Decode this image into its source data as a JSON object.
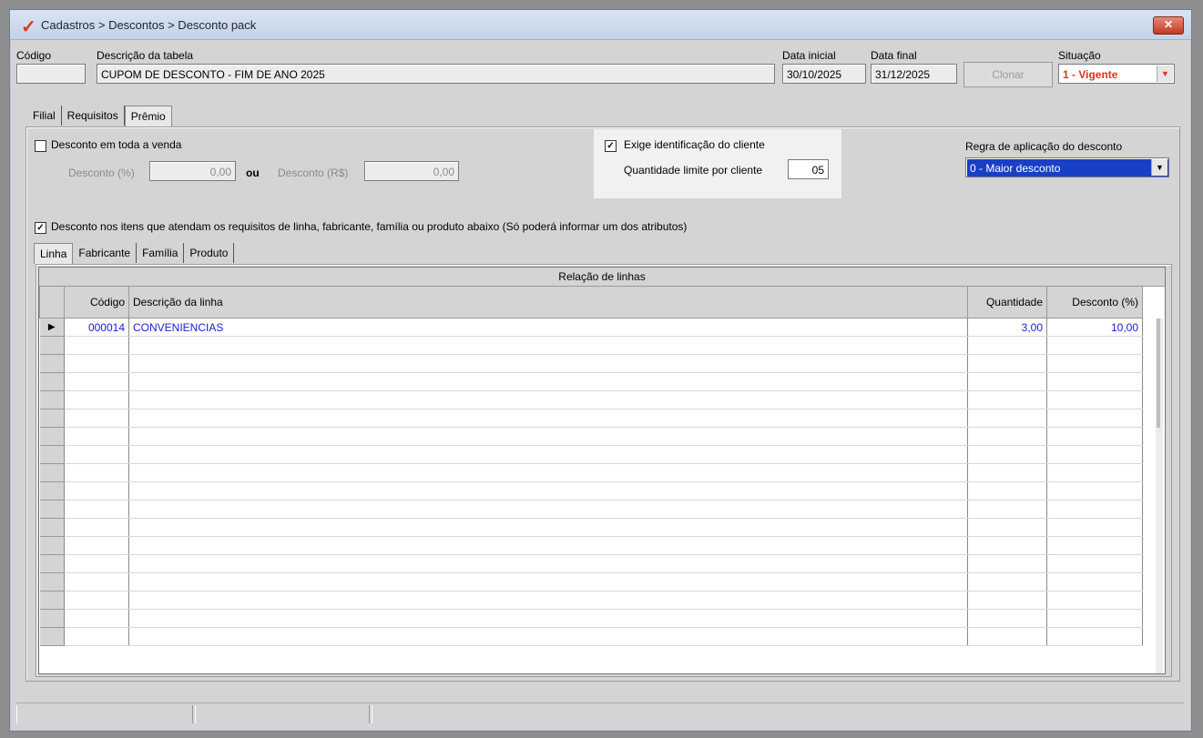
{
  "window": {
    "title": "Cadastros > Descontos > Desconto pack",
    "close_label": "✕"
  },
  "header": {
    "codigo_label": "Código",
    "codigo_value": "",
    "descricao_label": "Descrição da tabela",
    "descricao_value": "CUPOM DE DESCONTO - FIM DE ANO 2025",
    "data_inicial_label": "Data inicial",
    "data_inicial_value": "30/10/2025",
    "data_final_label": "Data final",
    "data_final_value": "31/12/2025",
    "clonar_label": "Clonar",
    "situacao_label": "Situação",
    "situacao_value": "1 - Vigente"
  },
  "tabs": [
    "Filial",
    "Requisitos",
    "Prêmio"
  ],
  "premio": {
    "desconto_toda_venda_label": "Desconto em toda a venda",
    "desconto_pct_label": "Desconto (%)",
    "desconto_pct_value": "0,00",
    "ou_label": "ou",
    "desconto_rs_label": "Desconto (R$)",
    "desconto_rs_value": "0,00",
    "exige_identificacao_label": "Exige identificação do cliente",
    "quantidade_limite_label": "Quantidade limite por cliente",
    "quantidade_limite_value": "05",
    "regra_label": "Regra de aplicação do desconto",
    "regra_value": "0 - Maior desconto",
    "desconto_itens_label": "Desconto nos itens que atendam os requisitos de linha, fabricante, família ou produto abaixo (Só poderá informar um dos atributos)"
  },
  "subtabs": [
    "Linha",
    "Fabricante",
    "Família",
    "Produto"
  ],
  "grid": {
    "caption": "Relação de linhas",
    "headers": [
      "Código",
      "Descrição da linha",
      "Quantidade",
      "Desconto (%)"
    ],
    "rows": [
      {
        "codigo": "000014",
        "descricao": "CONVENIENCIAS",
        "quantidade": "3,00",
        "desconto": "10,00"
      }
    ]
  },
  "colors": {
    "accent_red": "#e0331b",
    "selected_blue": "#1a3fc7",
    "grid_text": "#1a1ad6"
  }
}
